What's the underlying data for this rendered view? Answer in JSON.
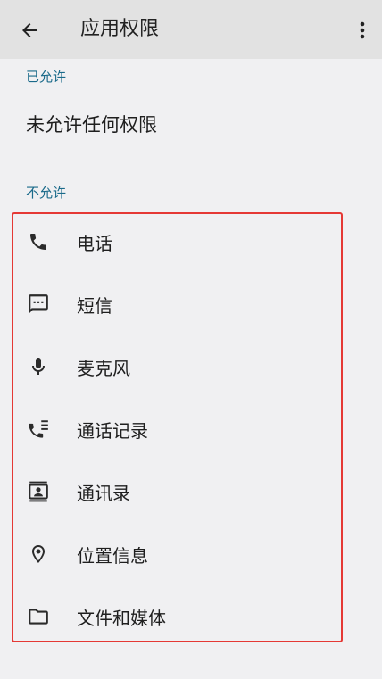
{
  "appbar": {
    "title": "应用权限"
  },
  "allowed": {
    "header": "已允许",
    "empty_text": "未允许任何权限"
  },
  "denied": {
    "header": "不允许",
    "items": [
      {
        "label": "电话",
        "icon": "phone-icon"
      },
      {
        "label": "短信",
        "icon": "sms-icon"
      },
      {
        "label": "麦克风",
        "icon": "microphone-icon"
      },
      {
        "label": "通话记录",
        "icon": "call-log-icon"
      },
      {
        "label": "通讯录",
        "icon": "contacts-icon"
      },
      {
        "label": "位置信息",
        "icon": "location-icon"
      },
      {
        "label": "文件和媒体",
        "icon": "folder-icon"
      }
    ]
  },
  "colors": {
    "section_header": "#1a6a8a",
    "highlight_border": "#e53935",
    "background": "#f0f0f2",
    "appbar": "#e2e2e2"
  }
}
